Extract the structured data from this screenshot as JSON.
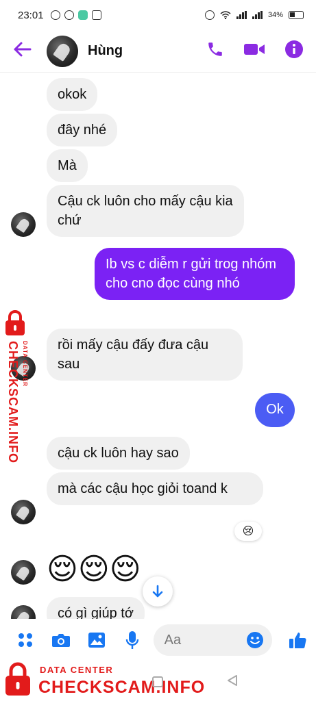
{
  "status_bar": {
    "time": "23:01",
    "battery": "34%"
  },
  "header": {
    "contact_name": "Hùng"
  },
  "messages": [
    {
      "text": "okok"
    },
    {
      "text": "đây nhé"
    },
    {
      "text": "Mà"
    },
    {
      "text": "Cậu ck luôn cho mấy cậu kia chứ"
    },
    {
      "text": "Ib vs c diễm r gửi trog nhóm cho cno đọc cùng nhó"
    },
    {
      "text": "rồi mấy cậu đấy đưa cậu sau"
    },
    {
      "text": "Ok"
    },
    {
      "text": "cậu ck luôn hay sao"
    },
    {
      "text": "mà các cậu học giỏi toand k"
    },
    {
      "text": "😌😌😌"
    },
    {
      "text": "có gì giúp tớ"
    }
  ],
  "reaction": "😢",
  "composer": {
    "placeholder": "Aa"
  },
  "watermark": {
    "line1": "DATA CENTER",
    "line2": "CHECKSCAM.INFO"
  },
  "colors": {
    "accent": "#8b2be2",
    "outgoing": "#7b22f4",
    "blue": "#1877f2",
    "watermark": "#e21b1b"
  }
}
